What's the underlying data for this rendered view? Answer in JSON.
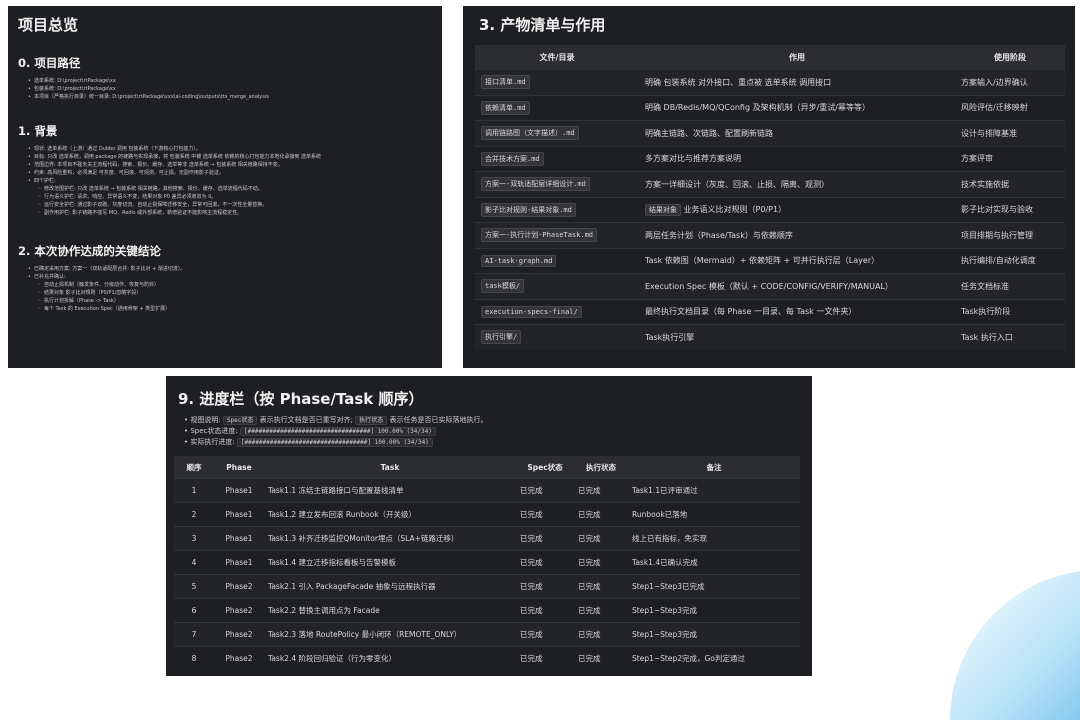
{
  "overview": {
    "title": "项目总览",
    "s0": {
      "heading": "0. 项目路径",
      "items": [
        "选单系统: D:\\project\\rtPackage\\xx",
        "包装系统: D:\\project\\rtPackage\\xx",
        "本项目（严格执行目录）统一目录: D:\\project\\rtPackage\\xxx\\ai-coding\\outputs\\tts_merge_analysis"
      ]
    },
    "s1": {
      "heading": "1. 背景",
      "items": [
        "现状: 选单系统（上游）通过 Dubbo 调用 包装系统（下游核心打包能力）。",
        "目标: 只改 选单系统，调用 package 的链路与实现承接，将 包装系统 中被 选单系统 依赖的核心打包能力本地化承接到 选单系统",
        "范围边界: 本项目不碰无关主流程代码，搜索、报价、缓存、选举等非 选单系统 → 包装系统 相关链路保持不变。",
        "约束: 高风险重构，必须满足 可灰度、可回滚、可观测、可止损、无副作用影子验证。",
        "四个护栏:"
      ],
      "subitems": [
        "修改范围护栏: 只改 选单系统 → 包装系统 相关链路，其他搜索、报价、缓存、选举流程代码不动。",
        "行为语义护栏: 请求、响应、异常语义不变，结果对象 P0 差异必须收敛为 0。",
        "运行安全护栏: 通过影子双跑、灰度切流、自动止损保障迁移安全，异常可回滚，不一次性全量替换。",
        "副作用护栏: 影子链路不能写 MQ、Redis 或外部系统，新增验证不能影响主流程稳定性。"
      ]
    },
    "s2": {
      "heading": "2. 本次协作达成的关键结论",
      "items": [
        "已确定采用方案: 方案一（双轨适配层合并: 影子比对 + 渐进切流）。",
        "已补充并确认:"
      ],
      "subitems": [
        "自动止损机制（触发条件、分级动作、恢复与防抖）",
        "结果对象 影子比对规则（P0/P1/忽略字段）",
        "执行计划拆解（Phase -> Task）",
        "每个 Task 的 Execution Spec（通用骨架 + 类型扩展）"
      ]
    }
  },
  "deliverables": {
    "title": "3. 产物清单与作用",
    "headers": [
      "文件/目录",
      "作用",
      "使用阶段"
    ],
    "rows": [
      {
        "file": "接口清单.md",
        "purpose": "明确 包装系统 对外接口、重点被 选单系统 调用接口",
        "stage": "方案输入/边界确认"
      },
      {
        "file": "依赖清单.md",
        "purpose": "明确 DB/Redis/MQ/QConfig 及架构机制（异步/重试/幂等等）",
        "stage": "风险评估/迁移映射"
      },
      {
        "file": "调用链路图（文字描述）.md",
        "purpose": "明确主链路、次链路、配置刷新链路",
        "stage": "设计与排障基准"
      },
      {
        "file": "合并技术方案.md",
        "purpose": "多方案对比与推荐方案说明",
        "stage": "方案评审"
      },
      {
        "file": "方案一-双轨适配层详细设计.md",
        "purpose": "方案一详细设计（灰度、回滚、止损、隔离、观测）",
        "stage": "技术实施依据"
      },
      {
        "file": "影子比对规则-结果对象.md",
        "purpose_tag": "结果对象",
        "purpose": "业务语义比对规则（P0/P1）",
        "stage": "影子比对实现与验收"
      },
      {
        "file": "方案一-执行计划-PhaseTask.md",
        "purpose": "两层任务计划（Phase/Task）与依赖顺序",
        "stage": "项目排期与执行管理"
      },
      {
        "file": "AI-task-graph.md",
        "purpose": "Task 依赖图（Mermaid）+ 依赖矩阵 + 可并行执行层（Layer）",
        "stage": "执行编排/自动化调度"
      },
      {
        "file": "task模板/",
        "purpose": "Execution Spec 模板（默认 + CODE/CONFIG/VERIFY/MANUAL）",
        "stage": "任务文档标准"
      },
      {
        "file": "execution-specs-final/",
        "purpose": "最终执行文档目录（每 Phase 一目录、每 Task 一文件夹）",
        "stage": "Task执行阶段"
      },
      {
        "file": "执行引擎/",
        "purpose": "Task执行引擎",
        "stage": "Task 执行入口"
      }
    ]
  },
  "progress": {
    "title": "9. 进度栏（按 Phase/Task 顺序）",
    "legend_label": "视图说明:",
    "legend_spec_tag": "Spec状态",
    "legend_spec_text": "表示执行文档是否已重写对齐;",
    "legend_exec_tag": "执行状态",
    "legend_exec_text": "表示任务是否已实际落地执行。",
    "spec_label": "Spec状态进度:",
    "spec_bar": "[##################################] 100.00% (34/34)",
    "exec_label": "实际执行进度:",
    "exec_bar": "[##################################] 100.00% (34/34)",
    "spec_percent": 100,
    "exec_percent": 100,
    "headers": [
      "顺序",
      "Phase",
      "Task",
      "Spec状态",
      "执行状态",
      "备注"
    ],
    "rows": [
      {
        "no": "1",
        "phase": "Phase1",
        "task": "Task1.1 冻结主链路接口与配置基线清单",
        "spec": "已完成",
        "exec": "已完成",
        "note": "Task1.1已评审通过"
      },
      {
        "no": "2",
        "phase": "Phase1",
        "task": "Task1.2 建立发布回滚 Runbook（开关级）",
        "spec": "已完成",
        "exec": "已完成",
        "note": "Runbook已落地"
      },
      {
        "no": "3",
        "phase": "Phase1",
        "task": "Task1.3 补齐迁移监控QMonitor埋点（SLA+链路迁移）",
        "spec": "已完成",
        "exec": "已完成",
        "note": "线上已有指标，免实现"
      },
      {
        "no": "4",
        "phase": "Phase1",
        "task": "Task1.4 建立迁移指标看板与告警模板",
        "spec": "已完成",
        "exec": "已完成",
        "note": "Task1.4已确认完成"
      },
      {
        "no": "5",
        "phase": "Phase2",
        "task": "Task2.1 引入 PackageFacade 抽象与远程执行器",
        "spec": "已完成",
        "exec": "已完成",
        "note": "Step1~Step3已完成"
      },
      {
        "no": "6",
        "phase": "Phase2",
        "task": "Task2.2 替换主调用点为 Facade",
        "spec": "已完成",
        "exec": "已完成",
        "note": "Step1~Step3完成"
      },
      {
        "no": "7",
        "phase": "Phase2",
        "task": "Task2.3 落地 RoutePolicy 最小闭环（REMOTE_ONLY）",
        "spec": "已完成",
        "exec": "已完成",
        "note": "Step1~Step3完成"
      },
      {
        "no": "8",
        "phase": "Phase2",
        "task": "Task2.4 阶段回归验证（行为零变化）",
        "spec": "已完成",
        "exec": "已完成",
        "note": "Step1~Step2完成，Go判定通过"
      }
    ]
  }
}
